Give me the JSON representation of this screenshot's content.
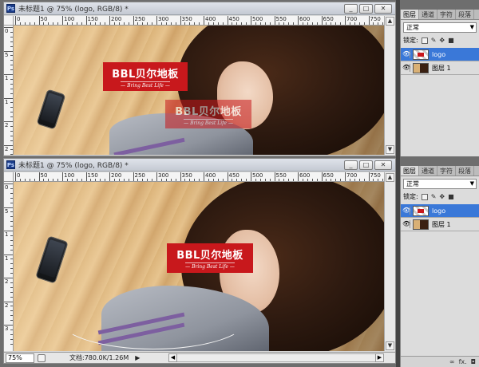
{
  "doc1": {
    "title": "未标题1 @ 75% (logo, RGB/8) *",
    "ruler_ticks": [
      "0",
      "50",
      "100",
      "150",
      "200",
      "250",
      "300",
      "350",
      "400",
      "450",
      "500",
      "550",
      "600",
      "650",
      "700",
      "750"
    ],
    "vruler_labels": [
      "0",
      "5",
      "1",
      "1",
      "2",
      "2"
    ]
  },
  "doc2": {
    "title": "未标题1 @ 75% (logo, RGB/8) *",
    "ruler_ticks": [
      "0",
      "50",
      "100",
      "150",
      "200",
      "250",
      "300",
      "350",
      "400",
      "450",
      "500",
      "550",
      "600",
      "650",
      "700",
      "750"
    ],
    "vruler_labels": [
      "0",
      "5",
      "1",
      "1",
      "2",
      "2",
      "3"
    ],
    "status": {
      "zoom": "75%",
      "doc_info": "文档:780.0K/1.26M",
      "arrow": "▶"
    }
  },
  "window_buttons": {
    "minimize": "_",
    "restore": "□",
    "close": "✕"
  },
  "logo": {
    "main_text": "BBL贝尔地板",
    "tagline": "— Bring Best Life —"
  },
  "layers_panel": {
    "tabs": [
      "图层",
      "通道",
      "字符",
      "段落"
    ],
    "blend_mode": "正常",
    "lock_label": "锁定:",
    "layers": [
      {
        "name": "logo",
        "selected": true
      },
      {
        "name": "图层 1",
        "selected": false
      }
    ],
    "footer_icons": [
      "∞",
      "fx.",
      "◘"
    ]
  },
  "colors": {
    "logo_red": "#c8181c",
    "selection_blue": "#3a78d8",
    "workspace": "#6e6e6e"
  }
}
